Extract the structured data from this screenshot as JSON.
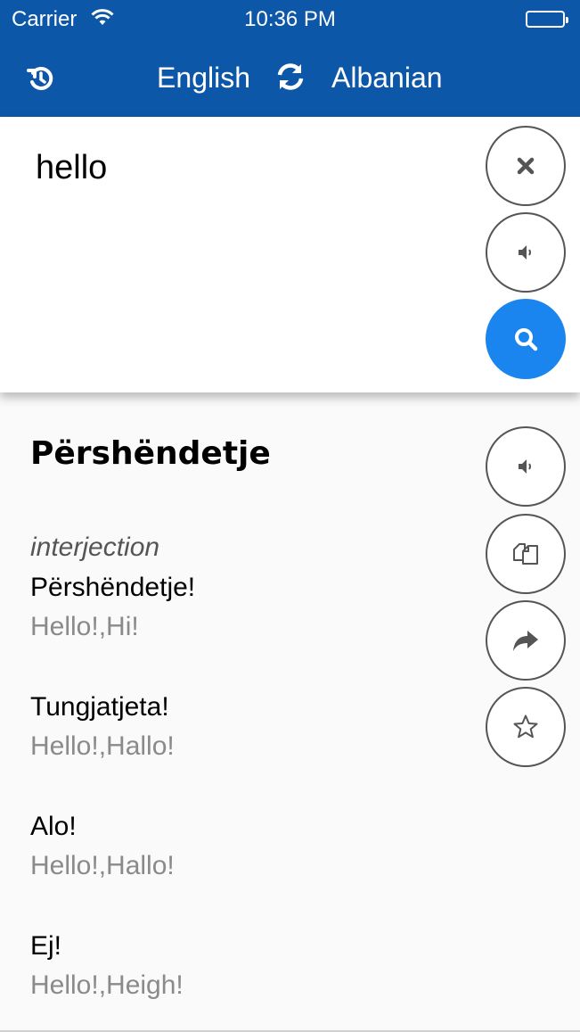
{
  "status_bar": {
    "carrier": "Carrier",
    "time": "10:36 PM"
  },
  "header": {
    "source_language": "English",
    "target_language": "Albanian",
    "history_icon": "history-icon",
    "swap_icon": "swap-languages-icon"
  },
  "input": {
    "text": "hello",
    "buttons": [
      "clear-icon",
      "speaker-icon",
      "search-icon"
    ]
  },
  "result": {
    "headword": "Përshëndetje",
    "part_of_speech": "interjection",
    "entries": [
      {
        "word": "Përshëndetje!",
        "gloss": "Hello!,Hi!"
      },
      {
        "word": "Tungjatjeta!",
        "gloss": "Hello!,Hallo!"
      },
      {
        "word": "Alo!",
        "gloss": "Hello!,Hallo!"
      },
      {
        "word": "Ej!",
        "gloss": "Hello!,Heigh!"
      }
    ],
    "actions": [
      "speaker-icon",
      "copy-icon",
      "share-icon",
      "star-icon"
    ]
  },
  "colors": {
    "header_bg": "#0d57a8",
    "search_button": "#1b85ef",
    "gloss_text": "#8a8a8a"
  }
}
